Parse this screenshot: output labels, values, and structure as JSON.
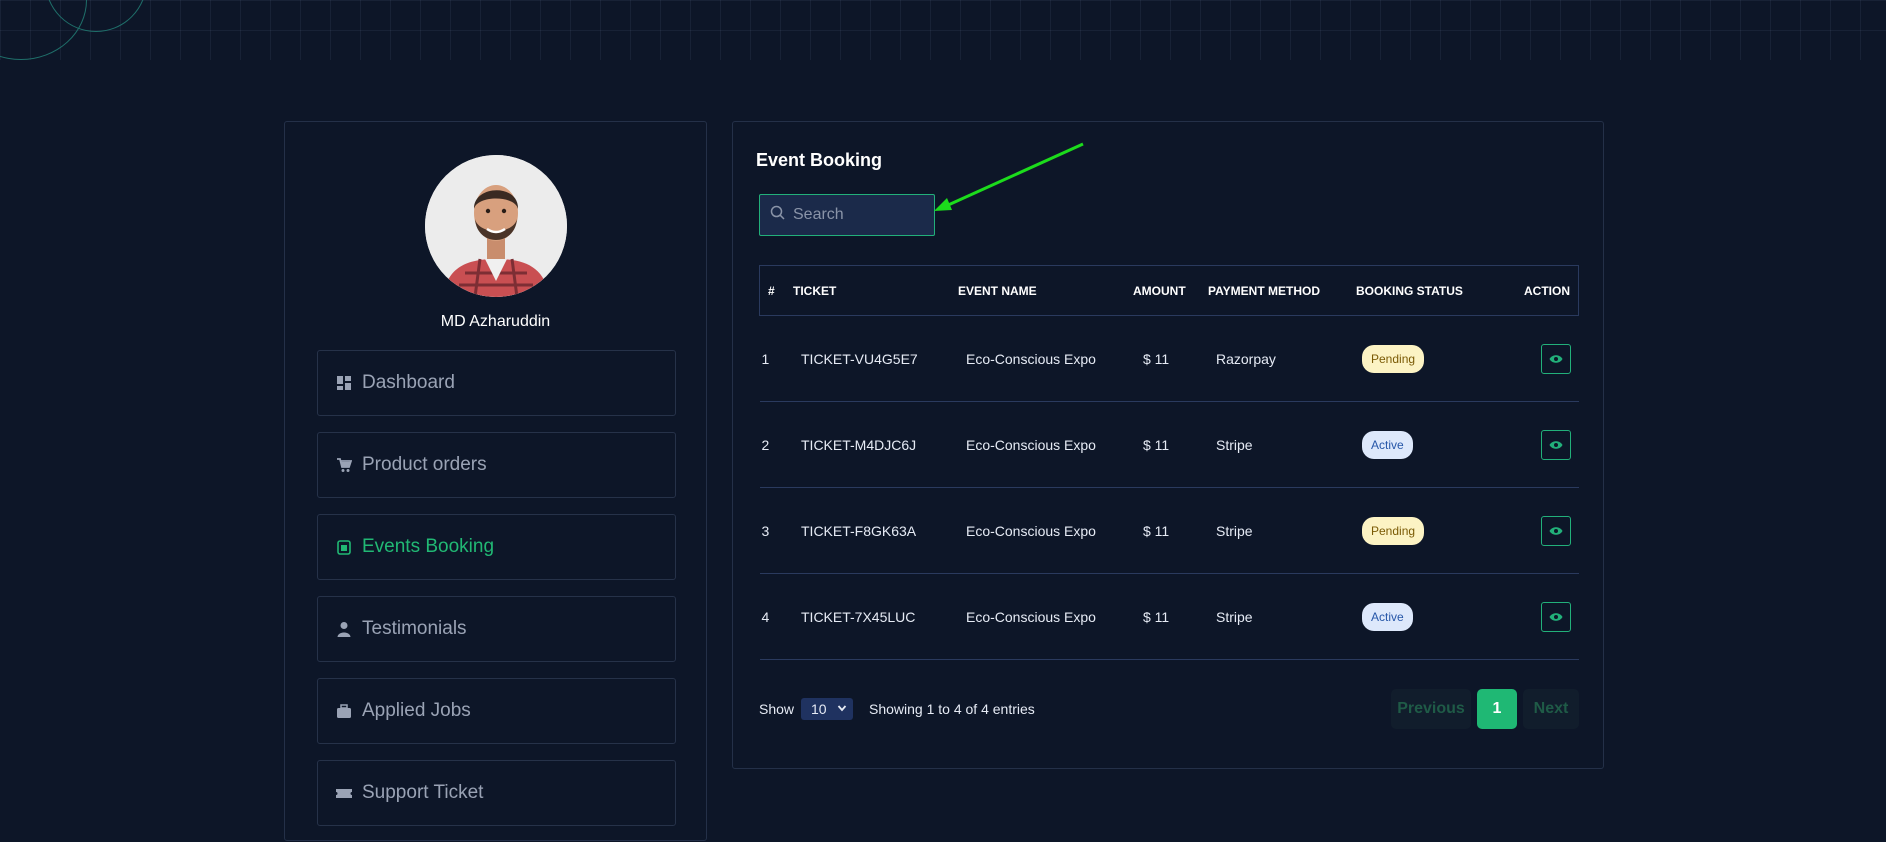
{
  "profile": {
    "name": "MD Azharuddin"
  },
  "menu": [
    {
      "label": "Dashboard",
      "icon": "dashboard-icon",
      "active": false
    },
    {
      "label": "Product orders",
      "icon": "cart-icon",
      "active": false
    },
    {
      "label": "Events Booking",
      "icon": "calendar-icon",
      "active": true
    },
    {
      "label": "Testimonials",
      "icon": "user-icon",
      "active": false
    },
    {
      "label": "Applied Jobs",
      "icon": "briefcase-icon",
      "active": false
    },
    {
      "label": "Support Ticket",
      "icon": "ticket-icon",
      "active": false
    }
  ],
  "main": {
    "title": "Event Booking",
    "search": {
      "placeholder": "Search",
      "value": ""
    },
    "columns": [
      "#",
      "TICKET",
      "EVENT NAME",
      "AMOUNT",
      "PAYMENT METHOD",
      "BOOKING STATUS",
      "ACTION"
    ],
    "rows": [
      {
        "num": "1",
        "ticket": "TICKET-VU4G5E7",
        "event": "Eco-Conscious Expo",
        "amount": "$ 11",
        "payment": "Razorpay",
        "status": "Pending"
      },
      {
        "num": "2",
        "ticket": "TICKET-M4DJC6J",
        "event": "Eco-Conscious Expo",
        "amount": "$ 11",
        "payment": "Stripe",
        "status": "Active"
      },
      {
        "num": "3",
        "ticket": "TICKET-F8GK63A",
        "event": "Eco-Conscious Expo",
        "amount": "$ 11",
        "payment": "Stripe",
        "status": "Pending"
      },
      {
        "num": "4",
        "ticket": "TICKET-7X45LUC",
        "event": "Eco-Conscious Expo",
        "amount": "$ 11",
        "payment": "Stripe",
        "status": "Active"
      }
    ],
    "footer": {
      "show_label": "Show",
      "page_size": "10",
      "entries_text": "Showing 1 to 4 of 4 entries",
      "previous_label": "Previous",
      "current_page": "1",
      "next_label": "Next"
    }
  },
  "colors": {
    "background": "#0d1628",
    "accent": "#1fb874",
    "pending_bg": "#fcf3c4",
    "active_bg": "#dde8fb",
    "annotation_arrow": "#1cdc1c"
  }
}
